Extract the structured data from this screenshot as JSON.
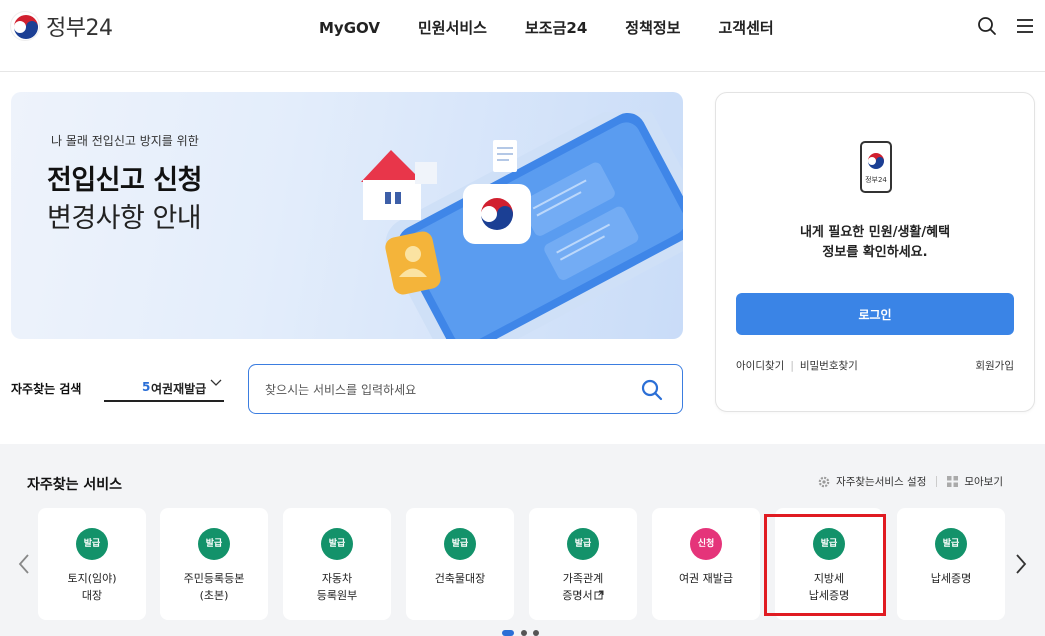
{
  "header": {
    "logo_text": "정부24",
    "nav": [
      "MyGOV",
      "민원서비스",
      "보조금24",
      "정책정보",
      "고객센터"
    ],
    "icons": [
      "search-icon",
      "menu-icon"
    ]
  },
  "hero": {
    "subtitle": "나 몰래 전입신고 방지를 위한",
    "title_line1": "전입신고 신청",
    "title_line2": "변경사항 안내"
  },
  "search": {
    "label": "자주찾는 검색",
    "keyword_rank": "5",
    "keyword_text": "여권재발급",
    "placeholder": "찾으시는 서비스를 입력하세요"
  },
  "login_card": {
    "phone_logo_text": "정부24",
    "message_line1": "내게 필요한 민원/생활/혜택",
    "message_line2": "정보를 확인하세요.",
    "login_button": "로그인",
    "find_id": "아이디찾기",
    "find_password": "비밀번호찾기",
    "signup": "회원가입"
  },
  "favorites": {
    "title": "자주찾는 서비스",
    "settings_label": "자주찾는서비스 설정",
    "view_all_label": "모아보기",
    "colors": {
      "issue": "#13926a",
      "apply": "#e5347a"
    },
    "cards": [
      {
        "badge": "발급",
        "badge_type": "issue",
        "line1": "토지(임야)",
        "line2": "대장"
      },
      {
        "badge": "발급",
        "badge_type": "issue",
        "line1": "주민등록등본",
        "line2": "(초본)"
      },
      {
        "badge": "발급",
        "badge_type": "issue",
        "line1": "자동차",
        "line2": "등록원부"
      },
      {
        "badge": "발급",
        "badge_type": "issue",
        "line1": "건축물대장",
        "line2": ""
      },
      {
        "badge": "발급",
        "badge_type": "issue",
        "line1": "가족관계",
        "line2": "증명서"
      },
      {
        "badge": "신청",
        "badge_type": "apply",
        "line1": "여권 재발급",
        "line2": ""
      },
      {
        "badge": "발급",
        "badge_type": "issue",
        "line1": "지방세",
        "line2": "납세증명"
      },
      {
        "badge": "발급",
        "badge_type": "issue",
        "line1": "납세증명",
        "line2": ""
      }
    ]
  }
}
